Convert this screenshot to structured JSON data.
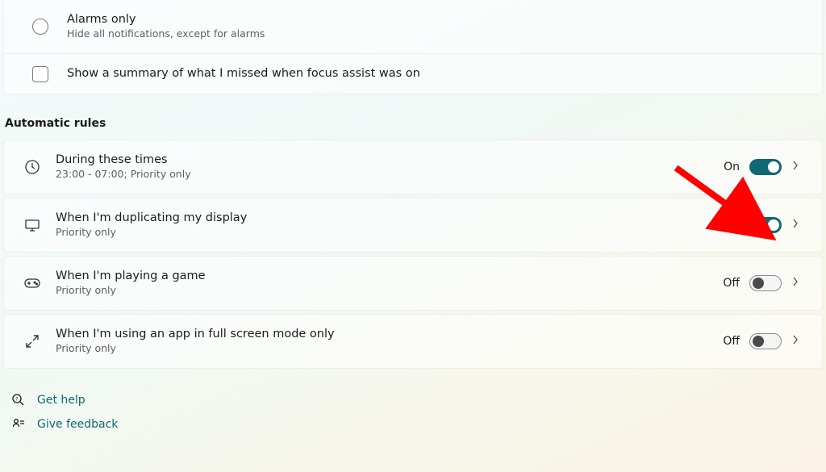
{
  "top": {
    "alarms_title": "Alarms only",
    "alarms_sub": "Hide all notifications, except for alarms",
    "summary_label": "Show a summary of what I missed when focus assist was on"
  },
  "section_heading": "Automatic rules",
  "rules": [
    {
      "title": "During these times",
      "sub": "23:00 - 07:00; Priority only",
      "state": "On",
      "on": true
    },
    {
      "title": "When I'm duplicating my display",
      "sub": "Priority only",
      "state": "On",
      "on": true
    },
    {
      "title": "When I'm playing a game",
      "sub": "Priority only",
      "state": "Off",
      "on": false
    },
    {
      "title": "When I'm using an app in full screen mode only",
      "sub": "Priority only",
      "state": "Off",
      "on": false
    }
  ],
  "footer": {
    "get_help": "Get help",
    "give_feedback": "Give feedback"
  }
}
